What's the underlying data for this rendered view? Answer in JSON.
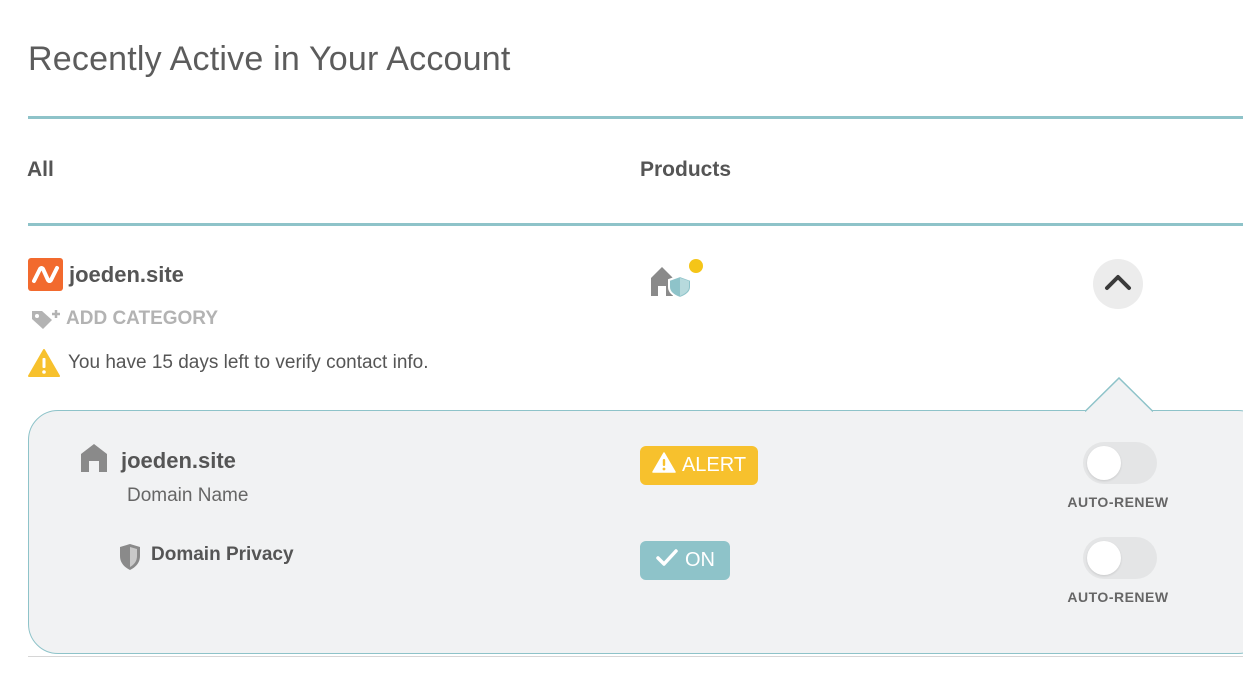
{
  "section": {
    "title": "Recently Active in Your Account",
    "columns": {
      "all": "All",
      "products": "Products"
    }
  },
  "domain_row": {
    "domain": "joeden.site",
    "brand_icon": "namecheap-logo-icon",
    "add_category_label": "ADD CATEGORY",
    "verify_notice": "You have 15 days left to verify contact info.",
    "product_icons": [
      "house-icon",
      "shield-icon",
      "notification-dot"
    ],
    "collapse_icon": "chevron-up-icon"
  },
  "details": {
    "items": [
      {
        "name": "joeden.site",
        "subtitle": "Domain Name",
        "icon": "house-icon",
        "status_label": "ALERT",
        "status_icon": "warning-icon",
        "status_color": "#f7c12d",
        "auto_renew_label": "AUTO-RENEW",
        "auto_renew_on": false
      },
      {
        "name": "Domain Privacy",
        "icon": "shield-icon",
        "status_label": "ON",
        "status_icon": "check-icon",
        "status_color": "#8ec3c9",
        "auto_renew_label": "AUTO-RENEW",
        "auto_renew_on": false
      }
    ]
  },
  "colors": {
    "accent_teal": "#8ec3c9",
    "brand_orange": "#f26a2e",
    "alert_yellow": "#f7c12d",
    "notification_dot": "#f5c518"
  }
}
